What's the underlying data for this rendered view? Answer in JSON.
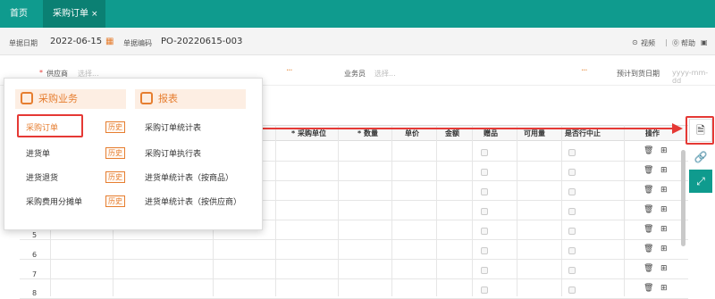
{
  "tabs": {
    "home": "首页",
    "active": "采购订单",
    "close": "×"
  },
  "info": {
    "date_label": "单据日期",
    "date_value": "2022-06-15",
    "no_label": "单据编码",
    "no_value": "PO-20220615-003",
    "video": "视频",
    "help": "帮助"
  },
  "form": {
    "supplier_label": "供应商",
    "supplier_ph": "选择...",
    "salesman_label": "业务员",
    "salesman_ph": "选择...",
    "arrival_label": "预计到货日期",
    "arrival_ph": "yyyy-mm-dd"
  },
  "columns": [
    "* 采购单位",
    "* 数量",
    "单价",
    "金额",
    "赠品",
    "可用量",
    "是否行中止",
    "操作"
  ],
  "rows": [
    "5",
    "6",
    "7",
    "8"
  ],
  "menu": {
    "cat1": "采购业务",
    "cat2": "报表",
    "left": [
      {
        "label": "采购订单",
        "tag": "历史"
      },
      {
        "label": "进货单",
        "tag": "历史"
      },
      {
        "label": "进货退货",
        "tag": "历史"
      },
      {
        "label": "采购费用分摊单",
        "tag": "历史"
      }
    ],
    "right": [
      "采购订单统计表",
      "采购订单执行表",
      "进货单统计表（按商品）",
      "进货单统计表（按供应商）"
    ]
  },
  "colors": {
    "teal": "#0f9b8e",
    "accent": "#e67e30",
    "red": "#e53935"
  }
}
